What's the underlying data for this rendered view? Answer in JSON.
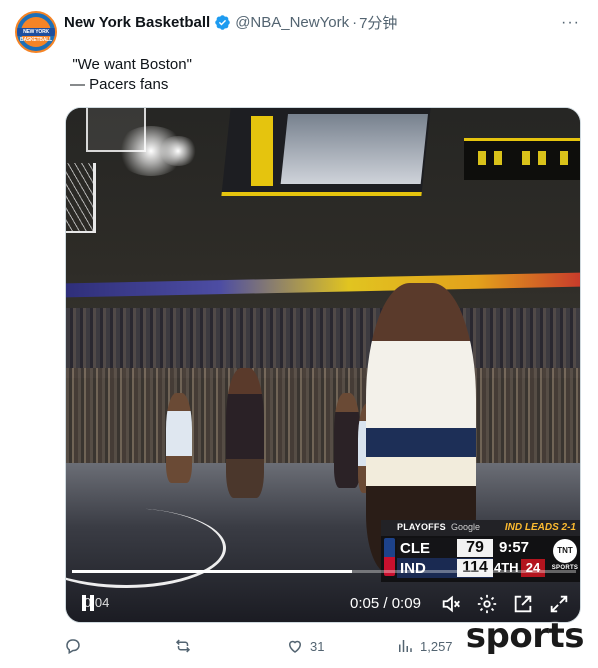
{
  "tweet": {
    "author": {
      "display_name": "New York Basketball",
      "handle": "@NBA_NewYork",
      "separator": "·",
      "time": "7分钟",
      "avatar_text": "NEW YORK BASKETBALL",
      "verified": true
    },
    "text_line1": "\"We want Boston\"",
    "text_line2": "— Pacers fans",
    "icons": {
      "more": "more-horizontal-icon",
      "verified": "verified-badge-icon"
    }
  },
  "video": {
    "scorebug": {
      "header": "PLAYOFFS",
      "sponsor": "Google",
      "series": "IND LEADS 2-1",
      "away_team": "CLE",
      "away_score": "79",
      "home_team": "IND",
      "home_score": "114",
      "clock": "9:57",
      "period": "4TH",
      "shot_clock": "24",
      "network": "TNT",
      "network_sub": "SPORTS"
    },
    "progress_fraction": 0.556,
    "elapsed_overlay": "0:04",
    "time_current": "0:05",
    "time_separator": "/",
    "time_total": "0:09",
    "controls": [
      "pause-icon",
      "volume-muted-icon",
      "settings-gear-icon",
      "pop-out-icon",
      "fullscreen-icon"
    ]
  },
  "actions": {
    "reply_count": "",
    "retweet_count": "",
    "like_count": "31",
    "views_count": "1,257"
  },
  "watermark": "sports",
  "colors": {
    "secondary_text": "#536471",
    "verified_blue": "#1d9bf0",
    "pacers_gold": "#fdbb30",
    "shot_clock_red": "#b3141e"
  }
}
